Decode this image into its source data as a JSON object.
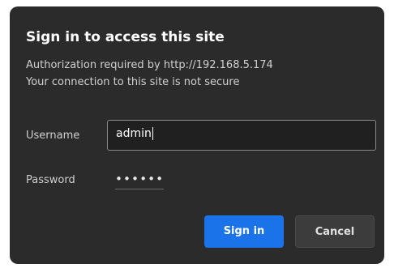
{
  "dialog": {
    "title": "Sign in to access this site",
    "message_line1": "Authorization required by http://192.168.5.174",
    "message_line2": "Your connection to this site is not secure",
    "username_label": "Username",
    "username_value": "admin",
    "password_label": "Password",
    "password_value": "••••••",
    "sign_in_label": "Sign in",
    "cancel_label": "Cancel"
  },
  "colors": {
    "dialog_background": "#2b2b2b",
    "primary_button": "#1a73e8",
    "secondary_button": "#3c3c3c"
  }
}
